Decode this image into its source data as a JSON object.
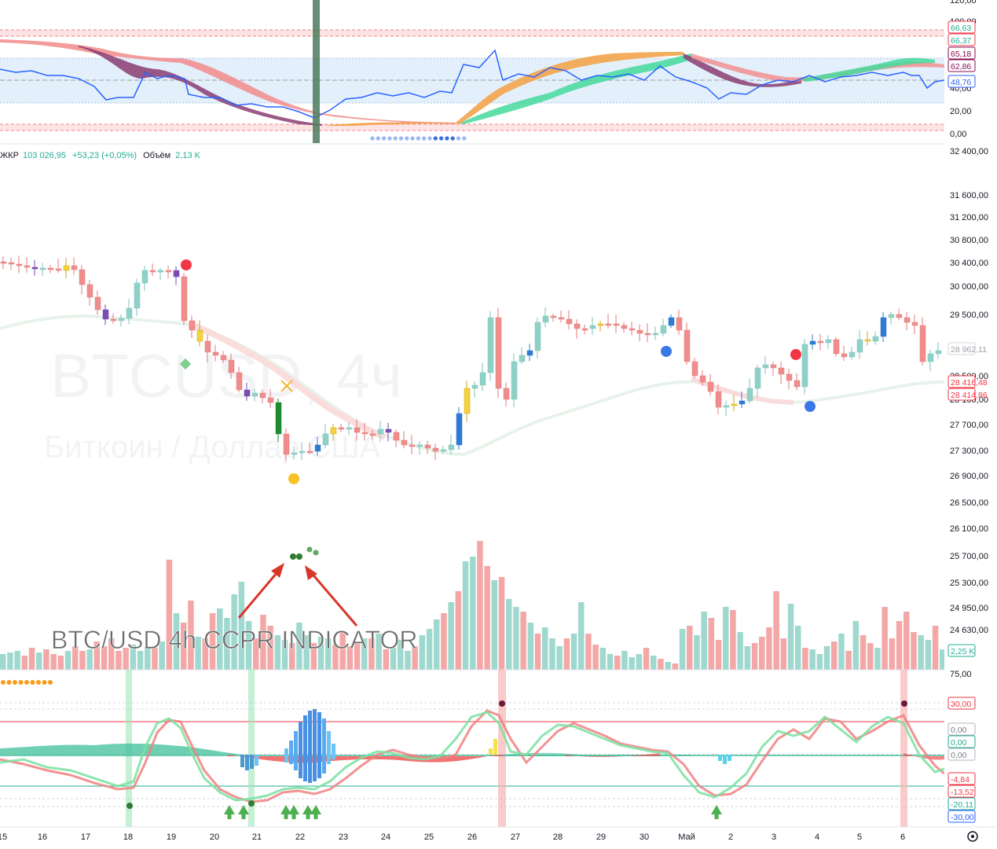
{
  "symbol_info": {
    "symbol": "BTCUSD",
    "interval": "4ч",
    "description": "Биткоин / Доллар США",
    "legend_prefix": "ЖКР",
    "legend_price": "103 026,95",
    "legend_change": "+53,23 (+0,05%)",
    "volume_label": "Объём",
    "volume_value": "2,13 K"
  },
  "annotation": {
    "caption": "BTC/USD 4h   CCPR INDICATOR",
    "arrow_color": "#d9362a"
  },
  "colors": {
    "up": "#8fd1c8",
    "down": "#f08c8c",
    "rsi_line": "#2962ff",
    "ma_pink": "#f5b7b7",
    "ma_green": "#cde9d6",
    "red_dot": "#f23645",
    "blue_dot": "#3b78e7",
    "yellow_dot": "#f7c325"
  },
  "top_pane": {
    "axis_ticks": [
      "120,00",
      "100,00",
      "40,00",
      "20,00",
      "0,00"
    ],
    "price_labels": [
      {
        "text": "66,63",
        "color": "#22ab94",
        "border": "#f23645"
      },
      {
        "text": "66,37",
        "color": "#22ab94",
        "border": "#f23645"
      },
      {
        "text": "65,18",
        "color": "#880e4f",
        "border": "#880e4f"
      },
      {
        "text": "62,86",
        "color": "#880e4f",
        "border": "#880e4f"
      },
      {
        "text": "48,76",
        "color": "#2962ff",
        "border": "#2962ff"
      }
    ]
  },
  "main_pane": {
    "axis_ticks": [
      "32 400,00",
      "31 600,00",
      "31 200,00",
      "30 800,00",
      "30 400,00",
      "30 000,00",
      "29 500,00",
      "28 500,00",
      "28 100,00",
      "27 700,00",
      "27 300,00",
      "26 900,00",
      "26 500,00",
      "26 100,00",
      "25 700,00",
      "25 300,00",
      "24 950,00",
      "24 630,00"
    ],
    "price_labels": [
      {
        "text": "28 962,11",
        "color": "#9aa0a6",
        "border": "#d1d4dc"
      },
      {
        "text": "28 416,48",
        "color": "#f23645",
        "border": "#f23645"
      },
      {
        "text": "28 414,86",
        "color": "#f23645",
        "border": "#f23645"
      }
    ],
    "volume_label": {
      "text": "2,25 K",
      "color": "#22ab94",
      "border": "#22ab94"
    }
  },
  "bottom_pane": {
    "axis_ticks": [
      "75,00",
      "30,00"
    ],
    "price_labels": [
      {
        "text": "30,00",
        "color": "#f23645",
        "border": "#f23645"
      },
      {
        "text": "0,00",
        "color": "#787b86",
        "border": "#b2b5be"
      },
      {
        "text": "0,00",
        "color": "#22ab94",
        "border": "#22ab94"
      },
      {
        "text": "0,00",
        "color": "#787b86",
        "border": "#b2b5be"
      },
      {
        "text": "-4,84",
        "color": "#f23645",
        "border": "#f23645"
      },
      {
        "text": "-13,52",
        "color": "#f23645",
        "border": "#f23645"
      },
      {
        "text": "-20,11",
        "color": "#22ab94",
        "border": "#22ab94"
      },
      {
        "text": "-30,00",
        "color": "#2962ff",
        "border": "#2962ff"
      }
    ]
  },
  "time_axis": {
    "labels": [
      "15",
      "16",
      "17",
      "18",
      "19",
      "20",
      "21",
      "22",
      "23",
      "24",
      "25",
      "26",
      "27",
      "28",
      "29",
      "30",
      "Май",
      "2",
      "3",
      "4",
      "5",
      "6"
    ],
    "settings_icon": "gear-icon"
  }
}
